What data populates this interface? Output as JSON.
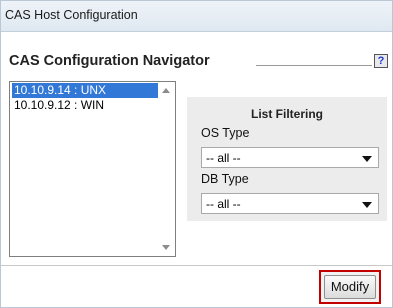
{
  "window": {
    "title": "CAS Host Configuration"
  },
  "navigator": {
    "title": "CAS Configuration Navigator",
    "help_icon": "question-mark-icon",
    "help_glyph": "?",
    "hosts": [
      {
        "label": "10.10.9.14 : UNX",
        "selected": true
      },
      {
        "label": "10.10.9.12 : WIN",
        "selected": false
      }
    ]
  },
  "filtering": {
    "heading": "List Filtering",
    "os_type": {
      "label": "OS Type",
      "value": "-- all --"
    },
    "db_type": {
      "label": "DB Type",
      "value": "-- all --"
    }
  },
  "actions": {
    "modify_label": "Modify"
  },
  "colors": {
    "selection": "#3178d7",
    "highlight_box": "#c20000",
    "panel": "#ececec"
  }
}
